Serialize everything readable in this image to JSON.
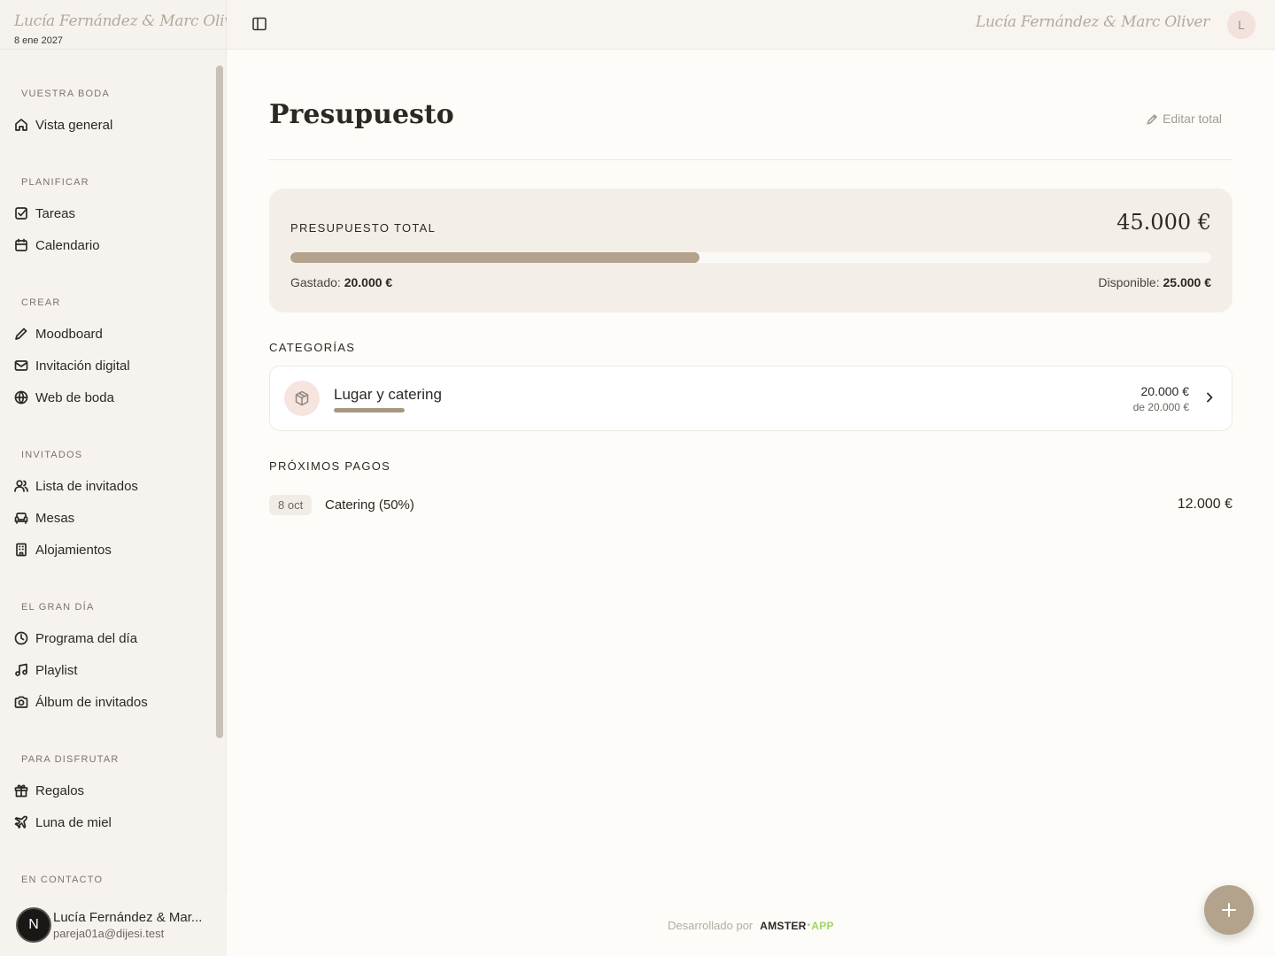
{
  "brand": {
    "names": "Lucía Fernández & Marc Oliver",
    "date": "8 ene 2027"
  },
  "sidebar": {
    "sections": [
      {
        "heading": "VUESTRA BODA",
        "items": [
          {
            "label": "Vista general",
            "icon": "home-icon"
          }
        ]
      },
      {
        "heading": "PLANIFICAR",
        "items": [
          {
            "label": "Tareas",
            "icon": "checkbox-icon"
          },
          {
            "label": "Calendario",
            "icon": "calendar-icon"
          }
        ]
      },
      {
        "heading": "CREAR",
        "items": [
          {
            "label": "Moodboard",
            "icon": "pen-icon"
          },
          {
            "label": "Invitación digital",
            "icon": "mail-icon"
          },
          {
            "label": "Web de boda",
            "icon": "globe-icon"
          }
        ]
      },
      {
        "heading": "INVITADOS",
        "items": [
          {
            "label": "Lista de invitados",
            "icon": "users-icon"
          },
          {
            "label": "Mesas",
            "icon": "sofa-icon"
          },
          {
            "label": "Alojamientos",
            "icon": "building-icon"
          }
        ]
      },
      {
        "heading": "EL GRAN DÍA",
        "items": [
          {
            "label": "Programa del día",
            "icon": "clock-icon"
          },
          {
            "label": "Playlist",
            "icon": "music-icon"
          },
          {
            "label": "Álbum de invitados",
            "icon": "camera-icon"
          }
        ]
      },
      {
        "heading": "PARA DISFRUTAR",
        "items": [
          {
            "label": "Regalos",
            "icon": "gift-icon"
          },
          {
            "label": "Luna de miel",
            "icon": "plane-icon"
          }
        ]
      },
      {
        "heading": "EN CONTACTO",
        "items": []
      }
    ]
  },
  "user": {
    "initial": "N",
    "name": "Lucía Fernández & Mar...",
    "email": "pareja01a@dijesi.test"
  },
  "topbar": {
    "names": "Lucía Fernández & Marc Oliver",
    "avatar_initial": "L"
  },
  "page": {
    "title": "Presupuesto",
    "edit_total": "Editar total"
  },
  "budget": {
    "label": "PRESUPUESTO TOTAL",
    "total": "45.000 €",
    "spent_label": "Gastado:",
    "spent": "20.000 €",
    "available_label": "Disponible:",
    "available": "25.000 €",
    "progress": 0.444
  },
  "categories": {
    "heading": "CATEGORÍAS",
    "items": [
      {
        "name": "Lugar y catering",
        "amount": "20.000 €",
        "of": "de 20.000 €",
        "progress": 1.0,
        "icon": "package-icon"
      }
    ]
  },
  "payments": {
    "heading": "PRÓXIMOS PAGOS",
    "items": [
      {
        "date": "8 oct",
        "name": "Catering (50%)",
        "amount": "12.000 €"
      }
    ]
  },
  "footer": {
    "developed_by": "Desarrollado por",
    "brand_a": "AMSTER",
    "brand_b": "APP"
  },
  "colors": {
    "accent": "#b3a28c",
    "sidebar_bg": "#f6f3ef",
    "page_bg": "#fefcf8",
    "card_bg": "#f3efe8"
  }
}
